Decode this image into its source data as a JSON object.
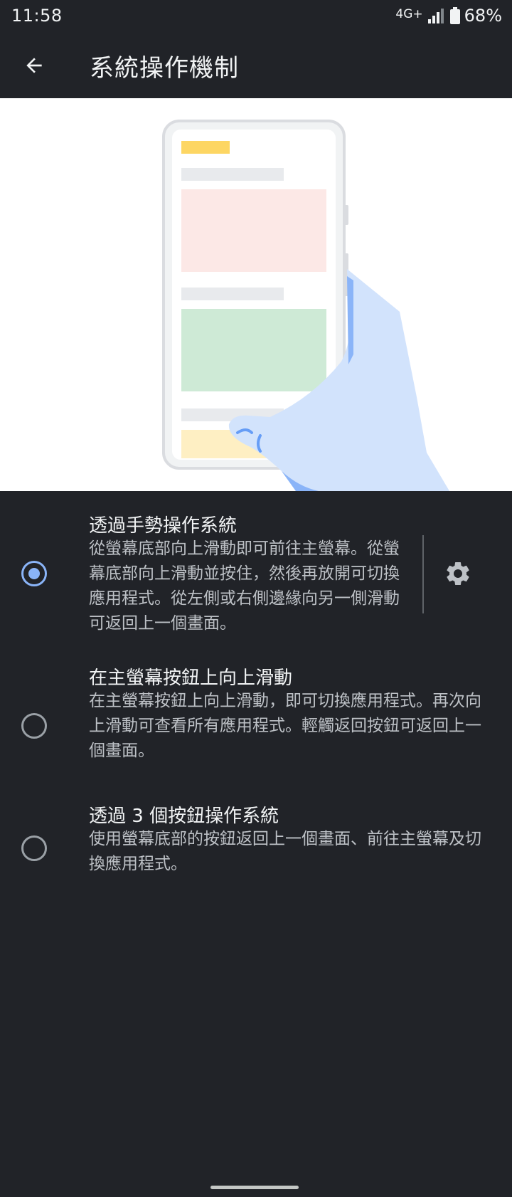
{
  "status": {
    "time": "11:58",
    "network": "4G+",
    "battery": "68%"
  },
  "app_bar": {
    "title": "系統操作機制"
  },
  "options": [
    {
      "title": "透過手勢操作系統",
      "description": "從螢幕底部向上滑動即可前往主螢幕。從螢幕底部向上滑動並按住，然後再放開可切換應用程式。從左側或右側邊緣向另一側滑動可返回上一個畫面。",
      "selected": true
    },
    {
      "title": "在主螢幕按鈕上向上滑動",
      "description": "在主螢幕按鈕上向上滑動，即可切換應用程式。再次向上滑動可查看所有應用程式。輕觸返回按鈕可返回上一個畫面。",
      "selected": false
    },
    {
      "title": "透過 3 個按鈕操作系統",
      "description": "使用螢幕底部的按鈕返回上一個畫面、前往主螢幕及切換應用程式。",
      "selected": false
    }
  ],
  "colors": {
    "background": "#212328",
    "accent": "#8ab4f8",
    "illustration_bg": "#ffffff"
  }
}
